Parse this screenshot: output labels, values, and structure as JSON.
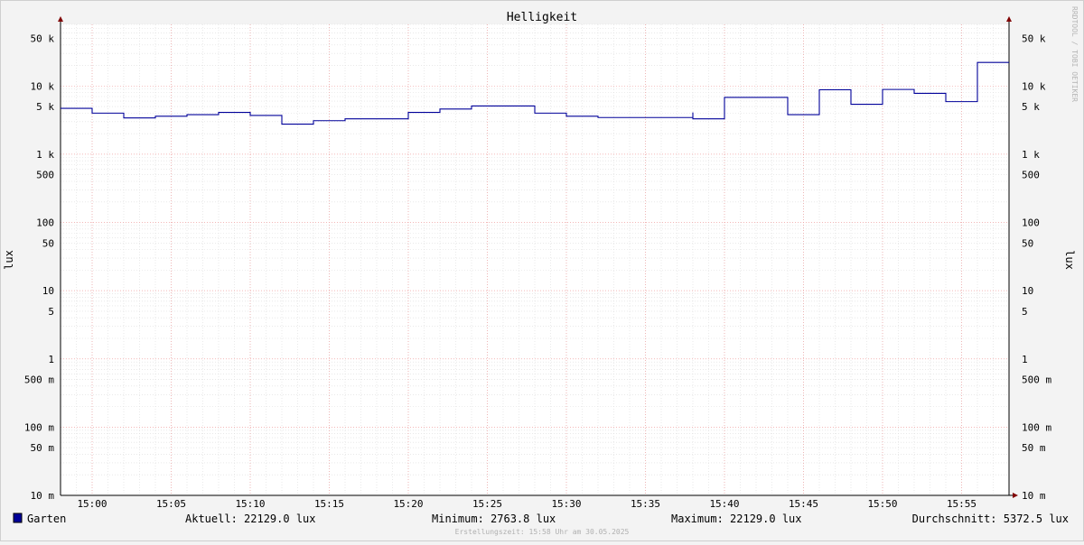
{
  "chart_data": {
    "type": "line",
    "title": "Helligkeit",
    "ylabel_left": "lux",
    "ylabel_right": "lux",
    "y_scale": "log",
    "ylim": [
      0.01,
      80000
    ],
    "y_ticks": [
      {
        "value": 50000,
        "label": "50 k"
      },
      {
        "value": 10000,
        "label": "10 k"
      },
      {
        "value": 5000,
        "label": "5 k"
      },
      {
        "value": 1000,
        "label": "1 k"
      },
      {
        "value": 500,
        "label": "500"
      },
      {
        "value": 100,
        "label": "100"
      },
      {
        "value": 50,
        "label": "50"
      },
      {
        "value": 10,
        "label": "10"
      },
      {
        "value": 5,
        "label": "5"
      },
      {
        "value": 1,
        "label": "1"
      },
      {
        "value": 0.5,
        "label": "500 m"
      },
      {
        "value": 0.1,
        "label": "100 m"
      },
      {
        "value": 0.05,
        "label": "50 m"
      },
      {
        "value": 0.01,
        "label": "10 m"
      }
    ],
    "x_range": [
      "14:58",
      "15:58"
    ],
    "x_ticks": [
      "15:00",
      "15:05",
      "15:10",
      "15:15",
      "15:20",
      "15:25",
      "15:30",
      "15:35",
      "15:40",
      "15:45",
      "15:50",
      "15:55"
    ],
    "grid": true,
    "series": [
      {
        "name": "Garten",
        "color": "#000099",
        "step": true,
        "points": [
          {
            "x": "14:58",
            "y": 4700
          },
          {
            "x": "15:00",
            "y": 4000
          },
          {
            "x": "15:02",
            "y": 3400
          },
          {
            "x": "15:04",
            "y": 3600
          },
          {
            "x": "15:06",
            "y": 3800
          },
          {
            "x": "15:08",
            "y": 4100
          },
          {
            "x": "15:10",
            "y": 3700
          },
          {
            "x": "15:12",
            "y": 2764
          },
          {
            "x": "15:14",
            "y": 3100
          },
          {
            "x": "15:16",
            "y": 3300
          },
          {
            "x": "15:20",
            "y": 4100
          },
          {
            "x": "15:22",
            "y": 4600
          },
          {
            "x": "15:24",
            "y": 5100
          },
          {
            "x": "15:28",
            "y": 4000
          },
          {
            "x": "15:30",
            "y": 3600
          },
          {
            "x": "15:32",
            "y": 3450
          },
          {
            "x": "15:38",
            "y": 4100
          },
          {
            "x": "15:38",
            "y": 3300
          },
          {
            "x": "15:40",
            "y": 6800
          },
          {
            "x": "15:44",
            "y": 3800
          },
          {
            "x": "15:46",
            "y": 8800
          },
          {
            "x": "15:48",
            "y": 5400
          },
          {
            "x": "15:50",
            "y": 8900
          },
          {
            "x": "15:52",
            "y": 7800
          },
          {
            "x": "15:54",
            "y": 5900
          },
          {
            "x": "15:56",
            "y": 22129
          }
        ]
      }
    ]
  },
  "legend": {
    "color": "#000099",
    "series_label": "Garten",
    "current": "Aktuell: 22129.0 lux",
    "minimum": "Minimum: 2763.8 lux",
    "maximum": "Maximum: 22129.0 lux",
    "average": "Durchschnitt: 5372.5 lux"
  },
  "footer": "Erstellungszeit: 15:58 Uhr am 30.05.2025",
  "watermark": "RRDTOOL / TOBI OETIKER"
}
